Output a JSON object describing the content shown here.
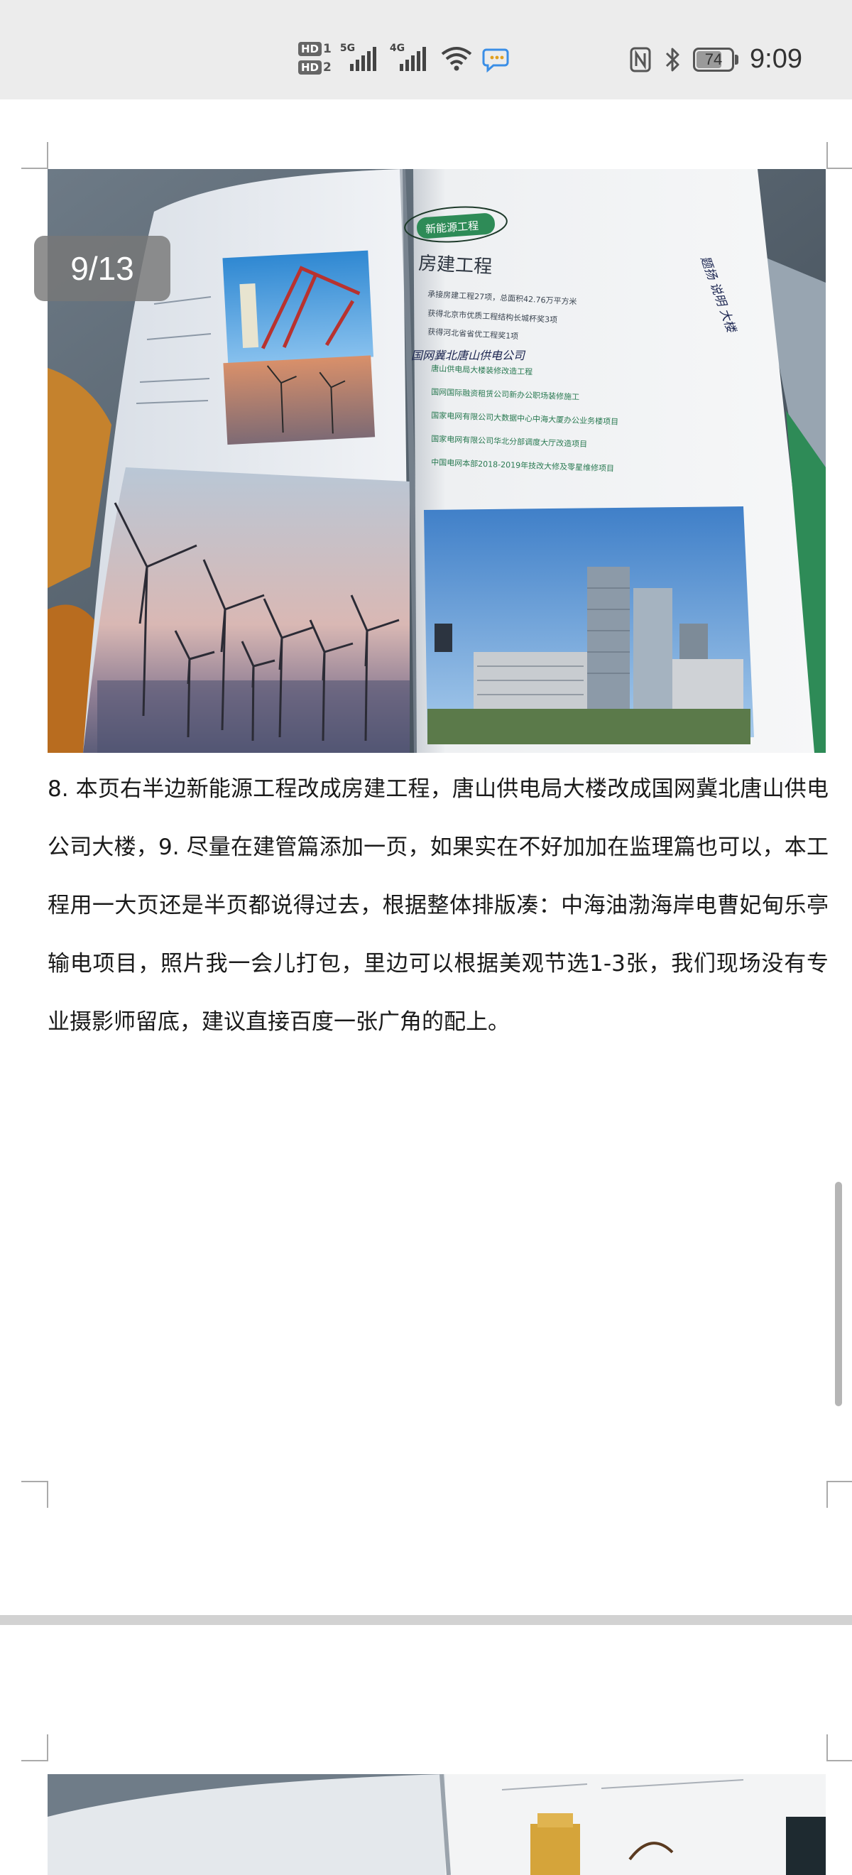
{
  "status_bar": {
    "sim1_label": "HD",
    "sim1_number": "1",
    "sim2_label": "HD",
    "sim2_number": "2",
    "network1": "5G",
    "network2": "4G",
    "battery_level": 74,
    "battery_text": "74",
    "time": "9:09"
  },
  "viewer": {
    "page_indicator": "9/13",
    "photo": {
      "section_tag": "新能源工程",
      "heading": "房建工程",
      "bullets": [
        "承接房建工程27项，总面积42.76万平方米",
        "获得北京市优质工程结构长城杯奖3项",
        "获得河北省省优工程奖1项"
      ],
      "handwritten_note": "国网冀北唐山供电公司",
      "handwritten_side": "题扬 说明 大楼",
      "projects": [
        "唐山供电局大楼装修改造工程",
        "国网国际融资租赁公司新办公职场装修施工",
        "国家电网有限公司大数据中心中海大厦办公业务楼项目",
        "国家电网有限公司华北分部调度大厅改造项目",
        "中国电网本部2018-2019年技改大修及零星维修项目"
      ]
    },
    "text": "8. 本页右半边新能源工程改成房建工程，唐山供电局大楼改成国网冀北唐山供电公司大楼，9.  尽量在建管篇添加一页，如果实在不好加加在监理篇也可以，本工程用一大页还是半页都说得过去，根据整体排版凑：中海油渤海岸电曹妃甸乐亭输电项目，照片我一会儿打包，里边可以根据美观节选1-3张，我们现场没有专业摄影师留底，建议直接百度一张广角的配上。"
  },
  "colors": {
    "status_bg": "#ececec",
    "pager_bg": "#787878",
    "separator": "#d2d2d2",
    "accent_green": "#2e8b57"
  }
}
